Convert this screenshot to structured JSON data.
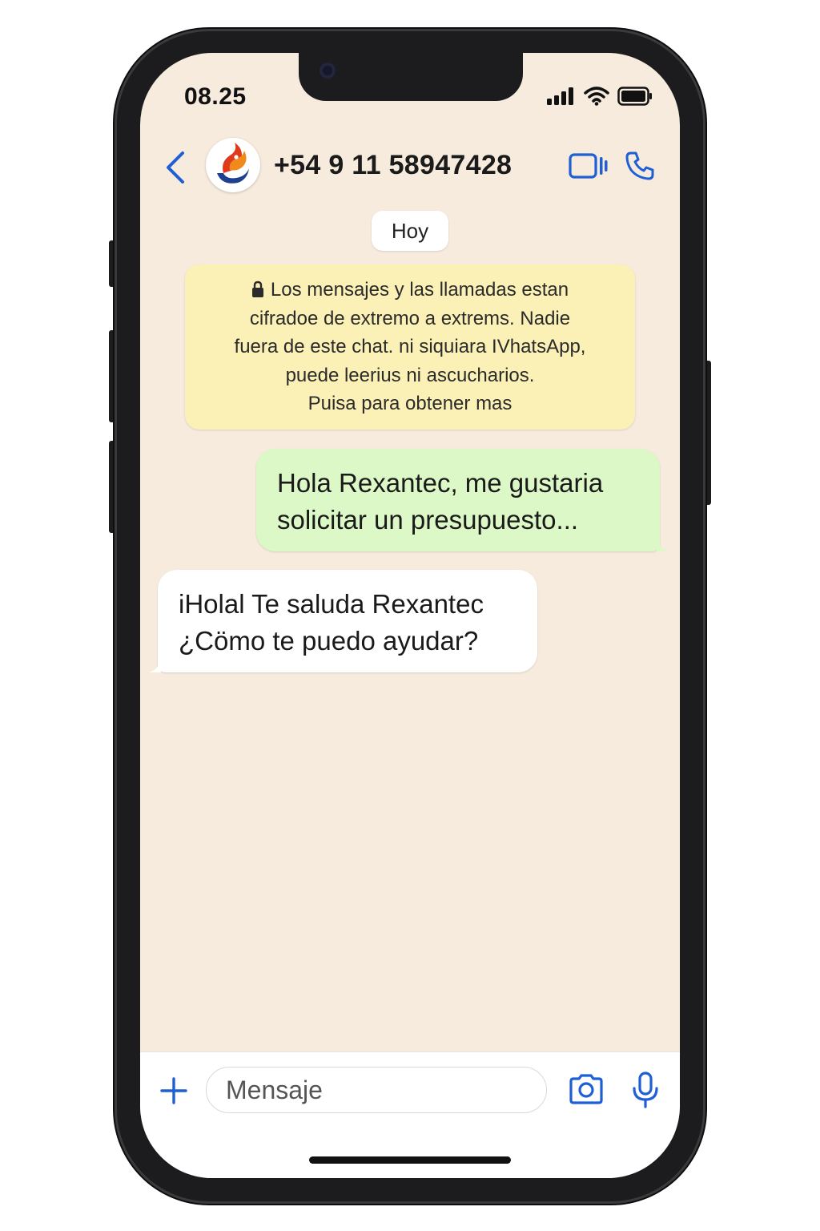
{
  "status_bar": {
    "time": "08.25",
    "icons": [
      "signal-icon",
      "wifi-icon",
      "battery-icon"
    ]
  },
  "header": {
    "contact_name": "+54 9 11 58947428",
    "icons": [
      "back-icon",
      "avatar-logo",
      "video-call-icon",
      "phone-call-icon"
    ]
  },
  "chat": {
    "date_label": "Hoy",
    "encryption_notice": [
      "Los mensajes y las llamadas estan",
      "cifradoe de extremo a extrems. Nadie",
      "fuera de este chat. ni siquiara IVhatsApp,",
      "puede leerius ni ascucharios.",
      "Puisa para obtener mas"
    ],
    "messages": [
      {
        "direction": "outgoing",
        "lines": [
          "Hola Rexantec, me gustaria",
          "solicitar un presupuesto..."
        ]
      },
      {
        "direction": "incoming",
        "lines": [
          "iHolal Te saluda Rexantec",
          "¿Cömo te puedo ayudar?"
        ]
      }
    ]
  },
  "input_bar": {
    "placeholder": "Mensaje",
    "value": "",
    "icons": [
      "plus-icon",
      "camera-icon",
      "microphone-icon"
    ]
  },
  "colors": {
    "accent": "#1f5fd6",
    "chat_background": "#f6ebdd",
    "outgoing_bubble": "#dcf8c6",
    "incoming_bubble": "#ffffff",
    "notice_background": "#fbf0b6"
  }
}
